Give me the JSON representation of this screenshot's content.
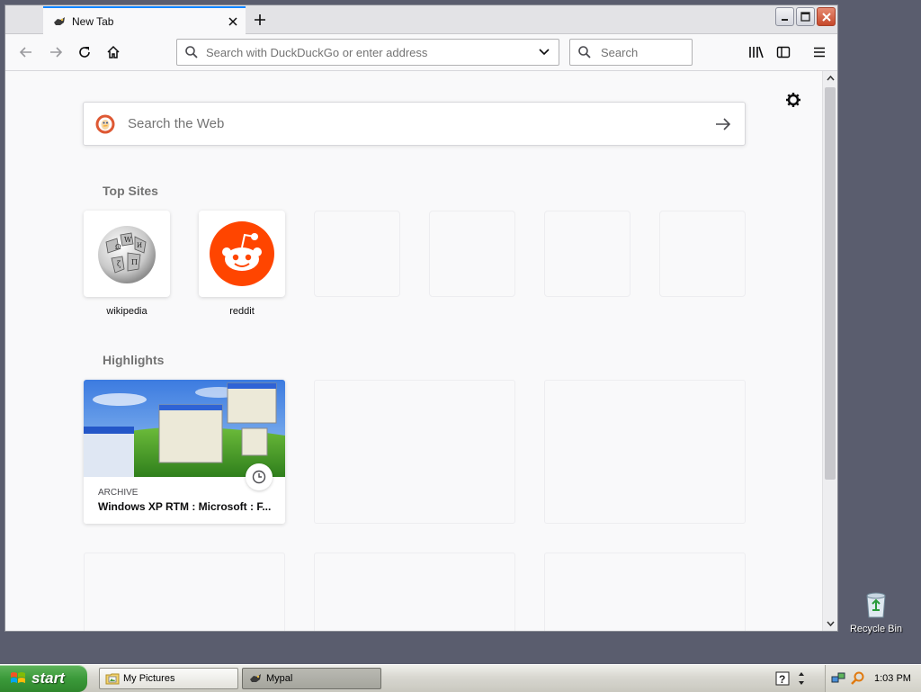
{
  "browser": {
    "tab": {
      "title": "New Tab"
    },
    "urlbar": {
      "placeholder": "Search with DuckDuckGo or enter address",
      "value": ""
    },
    "searchbar": {
      "placeholder": "Search",
      "value": ""
    }
  },
  "newtab": {
    "websearch": {
      "placeholder": "Search the Web"
    },
    "top_sites": {
      "title": "Top Sites",
      "sites": [
        {
          "label": "wikipedia",
          "icon": "wikipedia-globe-icon"
        },
        {
          "label": "reddit",
          "icon": "reddit-alien-icon"
        }
      ]
    },
    "highlights": {
      "title": "Highlights",
      "cards": [
        {
          "context": "ARCHIVE",
          "title": "Windows XP RTM : Microsoft : F..."
        }
      ]
    }
  },
  "desktop": {
    "icons": [
      {
        "label": "Recycle Bin"
      }
    ]
  },
  "taskbar": {
    "start_label": "start",
    "buttons": [
      {
        "label": "My Pictures",
        "active": false
      },
      {
        "label": "Mypal",
        "active": true
      }
    ],
    "clock": "1:03 PM"
  },
  "colors": {
    "accent": "#0a84ff",
    "reddit": "#ff4500",
    "ddg": "#de5833",
    "desktop": "#5a5d6e"
  }
}
